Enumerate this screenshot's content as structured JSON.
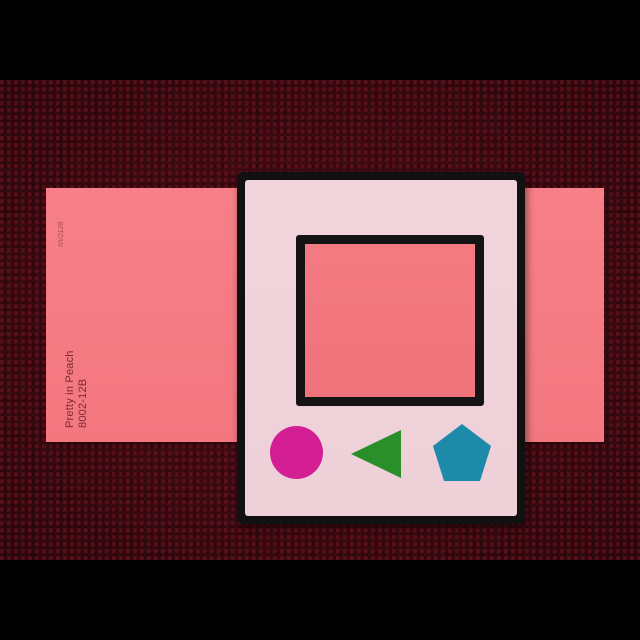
{
  "swatch": {
    "name": "Pretty in Peach",
    "code": "8002-12B",
    "small_code": "NV2128",
    "color": "#f47a82"
  },
  "card": {
    "shapes": [
      {
        "icon": "circle-icon",
        "color": "#d31f93"
      },
      {
        "icon": "triangle-icon",
        "color": "#2a8f2b"
      },
      {
        "icon": "pentagon-icon",
        "color": "#1c8aa8"
      }
    ]
  },
  "background": {
    "color": "#3a0a12"
  }
}
